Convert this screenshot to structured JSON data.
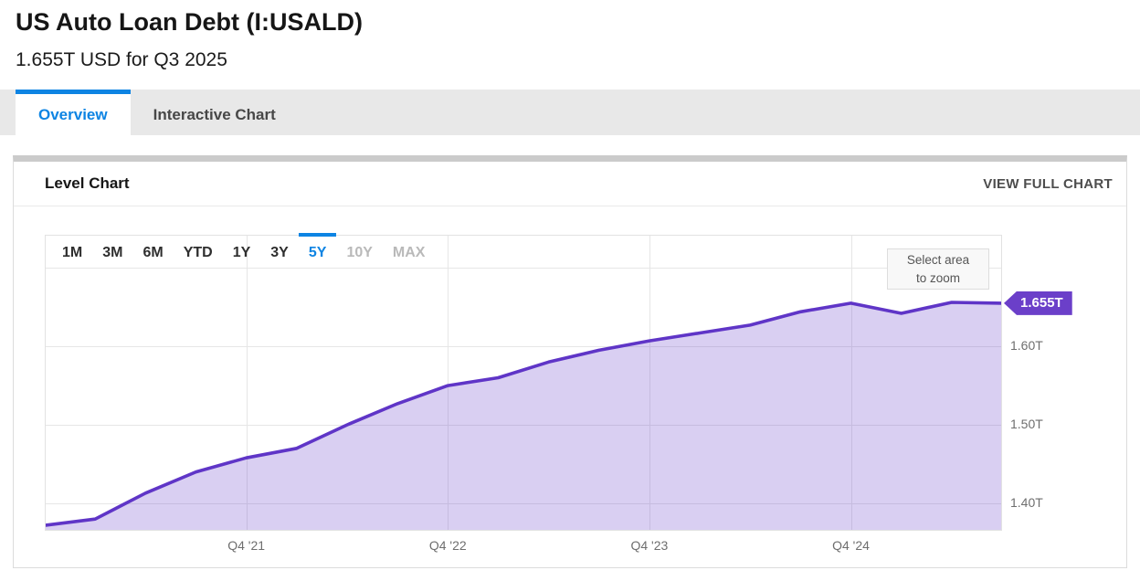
{
  "header": {
    "title": "US Auto Loan Debt (I:USALD)",
    "subtitle": "1.655T USD for Q3 2025"
  },
  "tabs": [
    {
      "label": "Overview",
      "active": true
    },
    {
      "label": "Interactive Chart",
      "active": false
    }
  ],
  "card": {
    "title": "Level Chart",
    "action": "VIEW FULL CHART"
  },
  "range_buttons": [
    {
      "label": "1M",
      "state": "normal"
    },
    {
      "label": "3M",
      "state": "normal"
    },
    {
      "label": "6M",
      "state": "normal"
    },
    {
      "label": "YTD",
      "state": "normal"
    },
    {
      "label": "1Y",
      "state": "normal"
    },
    {
      "label": "3Y",
      "state": "normal"
    },
    {
      "label": "5Y",
      "state": "active"
    },
    {
      "label": "10Y",
      "state": "disabled"
    },
    {
      "label": "MAX",
      "state": "disabled"
    }
  ],
  "zoom_hint": {
    "line1": "Select area",
    "line2": "to zoom"
  },
  "last_value_badge": "1.655T",
  "colors": {
    "accent_blue": "#0d84e3",
    "line_purple": "#5f35c7",
    "area_fill": "rgba(95,53,199,0.24)",
    "badge_purple": "#6b3fc9",
    "gridline": "#e6e6e6",
    "plot_border": "#e2e2e2"
  },
  "chart_data": {
    "type": "area",
    "title": "Level Chart",
    "unit": "USD trillions",
    "x": [
      "Q4 2020",
      "Q1 2021",
      "Q2 2021",
      "Q3 2021",
      "Q4 2021",
      "Q1 2022",
      "Q2 2022",
      "Q3 2022",
      "Q4 2022",
      "Q1 2023",
      "Q2 2023",
      "Q3 2023",
      "Q4 2023",
      "Q1 2024",
      "Q2 2024",
      "Q3 2024",
      "Q4 2024",
      "Q1 2025",
      "Q2 2025",
      "Q3 2025"
    ],
    "values": [
      1.372,
      1.38,
      1.413,
      1.44,
      1.458,
      1.47,
      1.5,
      1.527,
      1.55,
      1.56,
      1.58,
      1.595,
      1.607,
      1.617,
      1.627,
      1.644,
      1.655,
      1.642,
      1.656,
      1.655
    ],
    "ylim": [
      1.3651,
      1.7421
    ],
    "y_gridlines": [
      1.7,
      1.6,
      1.5,
      1.4
    ],
    "y_ticks": [
      {
        "value": 1.6,
        "label": "1.60T"
      },
      {
        "value": 1.5,
        "label": "1.50T"
      },
      {
        "value": 1.4,
        "label": "1.40T"
      }
    ],
    "x_ticks": [
      {
        "index": 4,
        "label": "Q4 '21"
      },
      {
        "index": 8,
        "label": "Q4 '22"
      },
      {
        "index": 12,
        "label": "Q4 '23"
      },
      {
        "index": 16,
        "label": "Q4 '24"
      }
    ],
    "legend": "none",
    "grid": true,
    "last_label": "1.655T"
  }
}
